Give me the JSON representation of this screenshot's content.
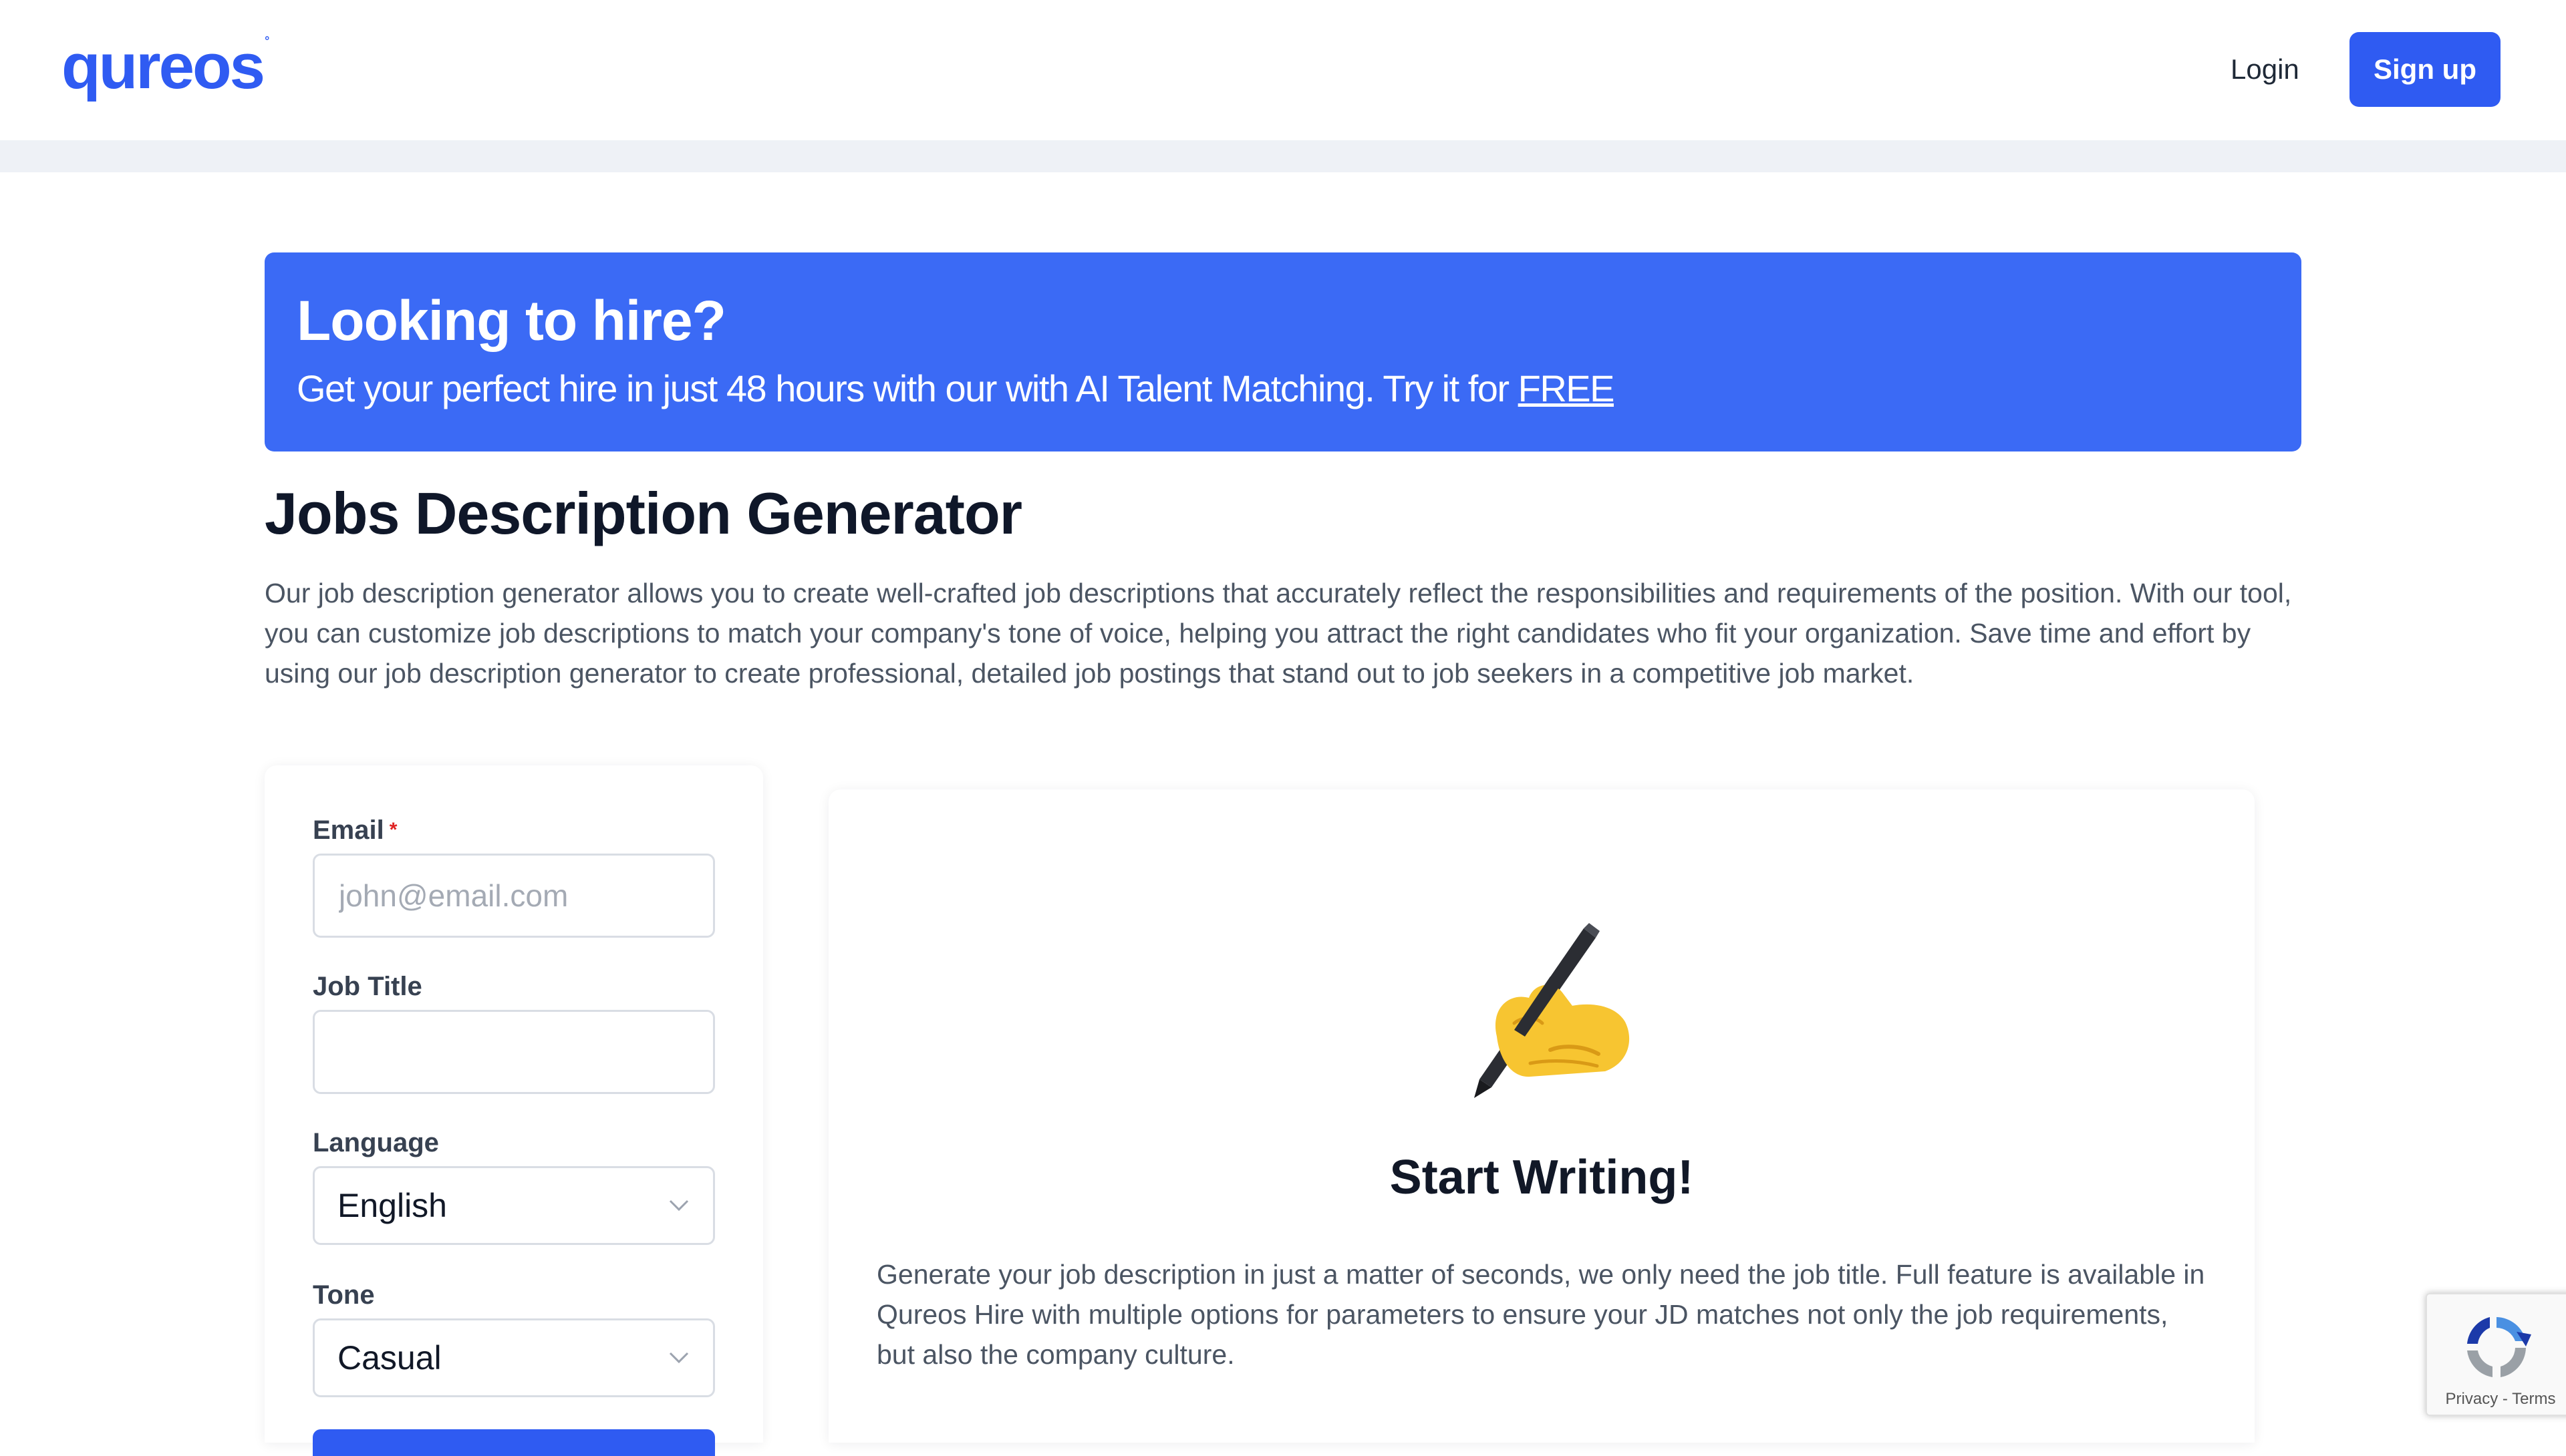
{
  "header": {
    "logo_text": "qureos",
    "login_label": "Login",
    "signup_label": "Sign up"
  },
  "banner": {
    "title": "Looking to hire?",
    "subtitle": "Get your perfect hire in just 48 hours with our with AI Talent Matching. Try it for ",
    "link_text": "FREE"
  },
  "page": {
    "title": "Jobs Description Generator",
    "description": "Our job description generator allows you to create well-crafted job descriptions that accurately reflect the responsibilities and requirements of the position. With our tool, you can customize job descriptions to match your company's tone of voice, helping you attract the right candidates who fit your organization. Save time and effort by using our job description generator to create professional, detailed job postings that stand out to job seekers in a competitive job market."
  },
  "form": {
    "email_label": "Email",
    "email_required_mark": "*",
    "email_placeholder": "john@email.com",
    "email_value": "",
    "job_title_label": "Job Title",
    "job_title_value": "",
    "language_label": "Language",
    "language_value": "English",
    "tone_label": "Tone",
    "tone_value": "Casual"
  },
  "result": {
    "icon": "writing-hand-icon",
    "title": "Start Writing!",
    "description": "Generate your job description in just a matter of seconds, we only need the job title. Full feature is available in Qureos Hire with multiple options for parameters to ensure your JD matches not only the job requirements, but also the company culture."
  },
  "recaptcha": {
    "links": "Privacy - Terms"
  },
  "colors": {
    "brand_blue": "#2f5bf2",
    "banner_blue": "#3b6af5",
    "title_dark": "#0f1729",
    "body_gray": "#4b5563"
  }
}
